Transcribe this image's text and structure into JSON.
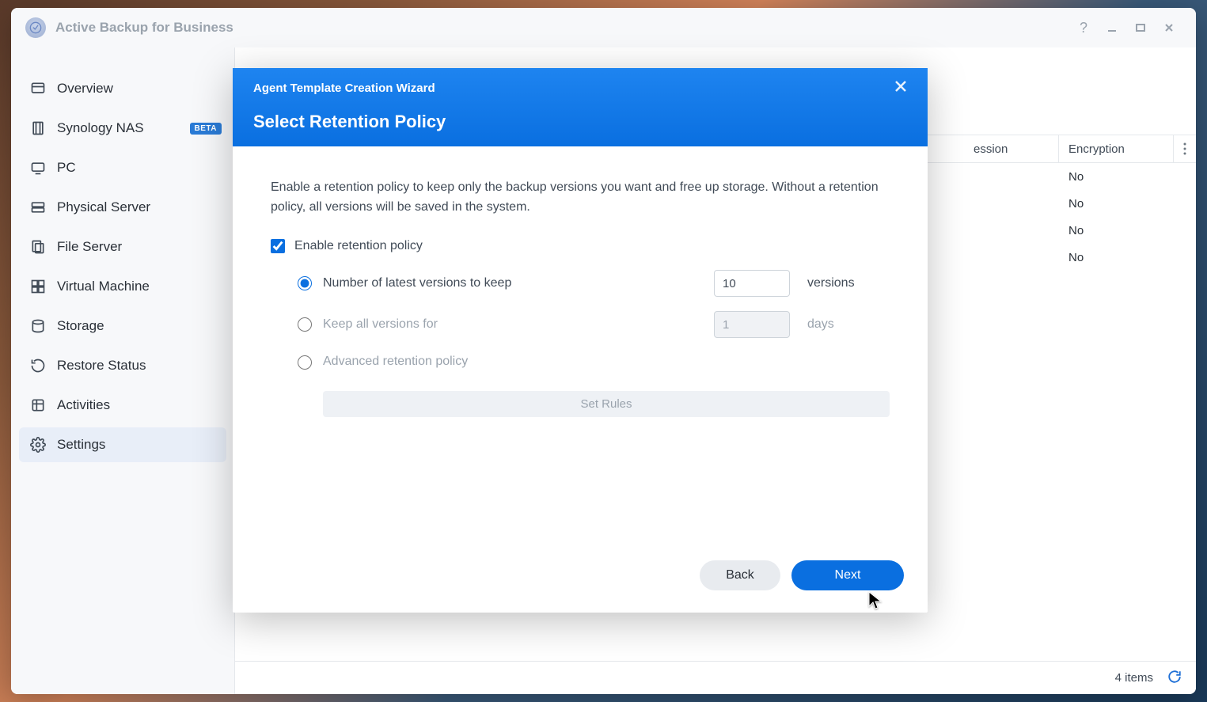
{
  "app": {
    "title": "Active Backup for Business"
  },
  "sidebar": {
    "items": [
      {
        "label": "Overview",
        "icon": "overview"
      },
      {
        "label": "Synology NAS",
        "icon": "nas",
        "badge": "BETA"
      },
      {
        "label": "PC",
        "icon": "pc"
      },
      {
        "label": "Physical Server",
        "icon": "server"
      },
      {
        "label": "File Server",
        "icon": "fileserver"
      },
      {
        "label": "Virtual Machine",
        "icon": "vm"
      },
      {
        "label": "Storage",
        "icon": "storage"
      },
      {
        "label": "Restore Status",
        "icon": "restore"
      },
      {
        "label": "Activities",
        "icon": "activities"
      },
      {
        "label": "Settings",
        "icon": "settings",
        "active": true
      }
    ]
  },
  "table": {
    "columns": {
      "compression": "ession",
      "encryption": "Encryption"
    },
    "rows": [
      {
        "encryption": "No"
      },
      {
        "encryption": "No"
      },
      {
        "encryption": "No"
      },
      {
        "encryption": "No"
      }
    ],
    "status": "4 items"
  },
  "modal": {
    "wizard_title": "Agent Template Creation Wizard",
    "step_title": "Select Retention Policy",
    "description": "Enable a retention policy to keep only the backup versions you want and free up storage. Without a retention policy, all versions will be saved in the system.",
    "enable_checkbox_label": "Enable retention policy",
    "enable_checked": true,
    "options": {
      "latest_versions": {
        "label": "Number of latest versions to keep",
        "value": "10",
        "suffix": "versions",
        "selected": true
      },
      "keep_all_for": {
        "label": "Keep all versions for",
        "value": "1",
        "suffix": "days",
        "selected": false
      },
      "advanced": {
        "label": "Advanced retention policy",
        "set_rules_label": "Set Rules",
        "selected": false
      }
    },
    "buttons": {
      "back": "Back",
      "next": "Next"
    }
  }
}
